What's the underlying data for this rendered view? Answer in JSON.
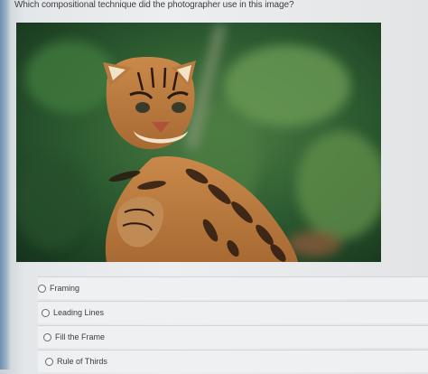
{
  "question": {
    "text": "Which compositional technique did the photographer use in this image?"
  },
  "image": {
    "subject_icon": "ocelot-photo",
    "accent": "#2f6a34"
  },
  "options": [
    {
      "label": "Framing"
    },
    {
      "label": "Leading Lines"
    },
    {
      "label": "Fill the Frame"
    },
    {
      "label": "Rule of Thirds"
    }
  ]
}
